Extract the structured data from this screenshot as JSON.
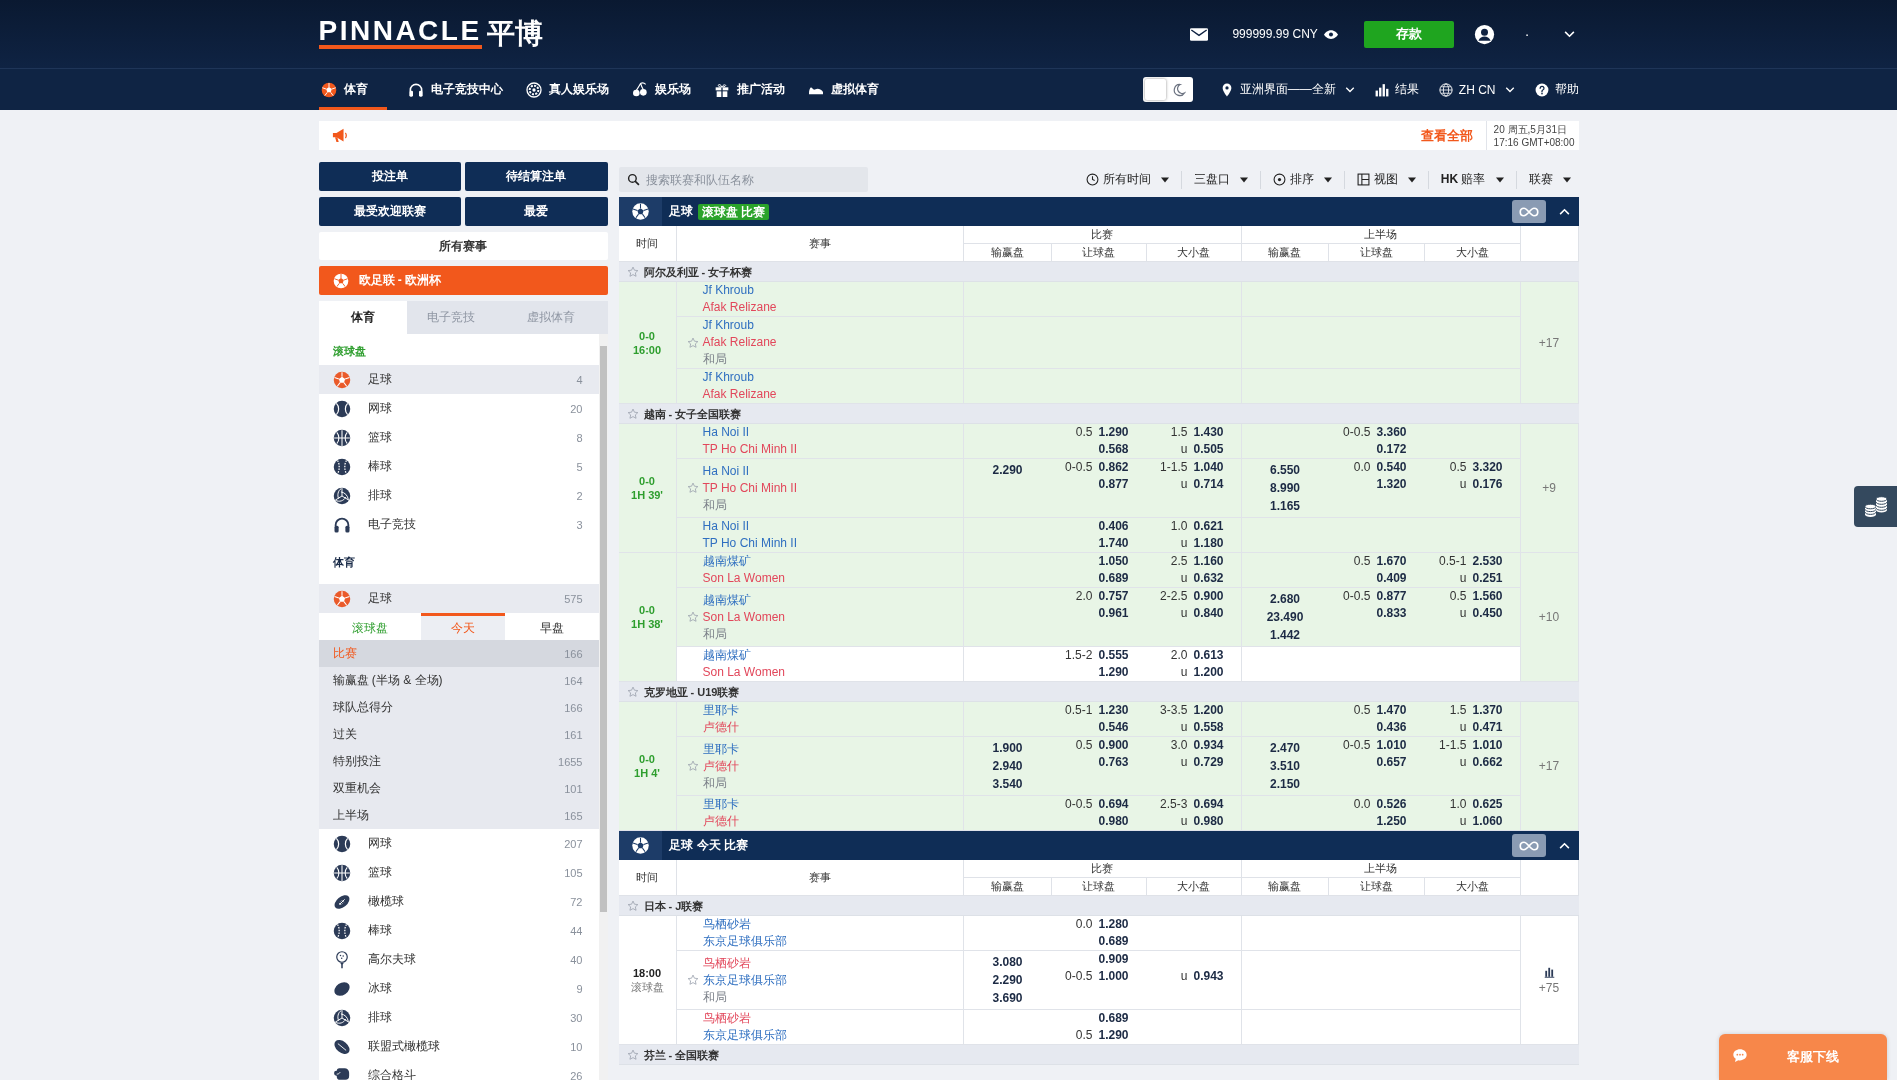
{
  "header": {
    "logo_word": "PINNACLE",
    "logo_chinese": "平博",
    "balance": "999999.99 CNY",
    "deposit": "存款",
    "username": "·"
  },
  "nav": {
    "items": [
      {
        "kind": "soccer",
        "label": "体育",
        "selected": true
      },
      {
        "kind": "headset",
        "label": "电子竞技中心",
        "selected": false
      },
      {
        "kind": "chip",
        "label": "真人娱乐场",
        "selected": false
      },
      {
        "kind": "cherries",
        "label": "娱乐场",
        "selected": false
      },
      {
        "kind": "gift",
        "label": "推广活动",
        "selected": false
      },
      {
        "kind": "virtual",
        "label": "虚拟体育",
        "selected": false
      }
    ],
    "dark_mode": false,
    "view": "亚洲界面——全新",
    "results": "结果",
    "language": "ZH CN",
    "help": "帮助"
  },
  "announcement": {
    "view_all": "查看全部",
    "date": "20 周五,5月31日",
    "time": "17:16 GMT+08:00"
  },
  "sidebar": {
    "buttons": [
      "投注单",
      "待结算注单",
      "最受欢迎联赛",
      "最爱"
    ],
    "all_events": "所有赛事",
    "featured": {
      "kind": "soccer",
      "label": "欧足联 - 欧洲杯"
    },
    "tabs": [
      {
        "label": "体育",
        "selected": true
      },
      {
        "label": "电子竞技",
        "selected": false
      },
      {
        "label": "虚拟体育",
        "selected": false
      }
    ],
    "live_heading": "滚球盘",
    "live_sports": [
      {
        "kind": "soccer",
        "name": "足球",
        "count": "4",
        "selected": true
      },
      {
        "kind": "tennis",
        "name": "网球",
        "count": "20",
        "selected": false
      },
      {
        "kind": "basketball",
        "name": "篮球",
        "count": "8",
        "selected": false
      },
      {
        "kind": "baseball",
        "name": "棒球",
        "count": "5",
        "selected": false
      },
      {
        "kind": "volleyball",
        "name": "排球",
        "count": "2",
        "selected": false
      },
      {
        "kind": "esports",
        "name": "电子竞技",
        "count": "3",
        "selected": false
      }
    ],
    "sports_heading": "体育",
    "sports": [
      {
        "kind": "soccer",
        "name": "足球",
        "count": "575",
        "selected": true,
        "periods": [
          {
            "label": "滚球盘",
            "live": true,
            "selected": false
          },
          {
            "label": "今天",
            "live": false,
            "selected": true
          },
          {
            "label": "早盘",
            "live": false,
            "selected": false
          }
        ],
        "markets": [
          {
            "label": "比赛",
            "count": "166",
            "selected": true
          },
          {
            "label": "输赢盘 (半场 & 全场)",
            "count": "164",
            "selected": false
          },
          {
            "label": "球队总得分",
            "count": "166",
            "selected": false
          },
          {
            "label": "过关",
            "count": "161",
            "selected": false
          },
          {
            "label": "特别投注",
            "count": "1655",
            "selected": false
          },
          {
            "label": "双重机会",
            "count": "101",
            "selected": false
          },
          {
            "label": "上半场",
            "count": "165",
            "selected": false
          }
        ]
      },
      {
        "kind": "tennis",
        "name": "网球",
        "count": "207",
        "selected": false
      },
      {
        "kind": "basketball",
        "name": "篮球",
        "count": "105",
        "selected": false
      },
      {
        "kind": "football",
        "name": "橄榄球",
        "count": "72",
        "selected": false
      },
      {
        "kind": "baseball",
        "name": "棒球",
        "count": "44",
        "selected": false
      },
      {
        "kind": "golf",
        "name": "高尔夫球",
        "count": "40",
        "selected": false
      },
      {
        "kind": "hockey",
        "name": "冰球",
        "count": "9",
        "selected": false
      },
      {
        "kind": "volleyball",
        "name": "排球",
        "count": "30",
        "selected": false
      },
      {
        "kind": "rugby_league",
        "name": "联盟式橄榄球",
        "count": "10",
        "selected": false
      },
      {
        "kind": "mma",
        "name": "综合格斗",
        "count": "26",
        "selected": false
      }
    ]
  },
  "toolbar": {
    "search": {
      "placeholder": "搜索联赛和队伍名称"
    },
    "filters": [
      {
        "kind": "clock",
        "label": "所有时间"
      },
      {
        "kind": "plain",
        "label": "三盘口"
      },
      {
        "kind": "sort",
        "label": "排序"
      },
      {
        "kind": "view",
        "label": "视图"
      },
      {
        "kind": "plain",
        "label": "**HK** 赔率"
      },
      {
        "kind": "plain",
        "label": "联赛"
      }
    ]
  },
  "sections": [
    {
      "kind": "soccer",
      "title": "足球",
      "subtitle": "滚球盘 比赛",
      "live": true,
      "expanded": true,
      "head": {
        "time": "时间",
        "event": "赛事",
        "groups": [
          {
            "label": "比赛",
            "columns": [
              "输赢盘",
              "让球盘",
              "大小盘"
            ]
          },
          {
            "label": "上半场",
            "columns": [
              "输赢盘",
              "让球盘",
              "大小盘"
            ]
          }
        ]
      },
      "leagues": [
        {
          "name": "阿尔及利亚 - 女子杯赛",
          "favorite": false,
          "matches": [
            {
              "time": [
                "0-0",
                "16:00"
              ],
              "live": true,
              "more": "+17",
              "stats": false,
              "lines": [
                {
                  "shaded": true,
                  "home": "Jf Khroub",
                  "home_emphasis": false,
                  "away": "Afak Relizane",
                  "away_emphasis": true
                },
                {
                  "shaded": true,
                  "home": "Jf Khroub",
                  "home_emphasis": false,
                  "away": "Afak Relizane",
                  "away_emphasis": true,
                  "draw": "和局"
                },
                {
                  "shaded": true,
                  "home": "Jf Khroub",
                  "home_emphasis": false,
                  "away": "Afak Relizane",
                  "away_emphasis": true
                }
              ]
            }
          ]
        },
        {
          "name": "越南 - 女子全国联赛",
          "favorite": false,
          "matches": [
            {
              "time": [
                "0-0",
                "1H 39'"
              ],
              "live": true,
              "more": "+9",
              "stats": false,
              "lines": [
                {
                  "shaded": true,
                  "home": "Ha Noi II",
                  "home_emphasis": false,
                  "away": "TP Ho Chi Minh II",
                  "away_emphasis": true,
                  "ft_hdp": {
                    "home_line": "0.5",
                    "home_odds": "1.290",
                    "away_odds": "0.568"
                  },
                  "ft_ou": {
                    "line": "1.5",
                    "over_odds": "1.430",
                    "under": "u",
                    "under_odds": "0.505"
                  },
                  "h1_hdp": {
                    "home_line": "0-0.5",
                    "home_odds": "3.360",
                    "away_odds": "0.172"
                  }
                },
                {
                  "shaded": true,
                  "home": "Ha Noi II",
                  "home_emphasis": false,
                  "away": "TP Ho Chi Minh II",
                  "away_emphasis": true,
                  "draw": "和局",
                  "ft_1x2": [
                    "2.290"
                  ],
                  "ft_hdp": {
                    "home_line": "0-0.5",
                    "home_odds": "0.862",
                    "away_odds": "0.877"
                  },
                  "ft_ou": {
                    "line": "1-1.5",
                    "over_odds": "1.040",
                    "under": "u",
                    "under_odds": "0.714"
                  },
                  "h1_1x2": [
                    "6.550",
                    "8.990",
                    "1.165"
                  ],
                  "h1_hdp": {
                    "home_line": "0.0",
                    "home_odds": "0.540",
                    "away_odds": "1.320"
                  },
                  "h1_ou": {
                    "line": "0.5",
                    "over_odds": "3.320",
                    "under": "u",
                    "under_odds": "0.176"
                  }
                },
                {
                  "shaded": true,
                  "home": "Ha Noi II",
                  "home_emphasis": false,
                  "away": "TP Ho Chi Minh II",
                  "away_emphasis": false,
                  "ft_hdp": {
                    "home_odds": "0.406",
                    "away_odds": "1.740"
                  },
                  "ft_ou": {
                    "line": "1.0",
                    "over_odds": "0.621",
                    "under": "u",
                    "under_odds": "1.180"
                  }
                }
              ]
            },
            {
              "time": [
                "0-0",
                "1H 38'"
              ],
              "live": true,
              "more": "+10",
              "stats": false,
              "lines": [
                {
                  "shaded": true,
                  "home": "越南煤矿",
                  "home_emphasis": false,
                  "away": "Son La Women",
                  "away_emphasis": true,
                  "ft_hdp": {
                    "home_odds": "1.050",
                    "away_odds": "0.689"
                  },
                  "ft_ou": {
                    "line": "2.5",
                    "over_odds": "1.160",
                    "under": "u",
                    "under_odds": "0.632"
                  },
                  "h1_hdp": {
                    "home_line": "0.5",
                    "home_odds": "1.670",
                    "away_odds": "0.409"
                  },
                  "h1_ou": {
                    "line": "0.5-1",
                    "over_odds": "2.530",
                    "under": "u",
                    "under_odds": "0.251"
                  }
                },
                {
                  "shaded": true,
                  "home": "越南煤矿",
                  "home_emphasis": false,
                  "away": "Son La Women",
                  "away_emphasis": true,
                  "draw": "和局",
                  "ft_hdp": {
                    "home_line": "2.0",
                    "home_odds": "0.757",
                    "away_odds": "0.961"
                  },
                  "ft_ou": {
                    "line": "2-2.5",
                    "over_odds": "0.900",
                    "under": "u",
                    "under_odds": "0.840"
                  },
                  "h1_1x2": [
                    "2.680",
                    "23.490",
                    "1.442"
                  ],
                  "h1_hdp": {
                    "home_line": "0-0.5",
                    "home_odds": "0.877",
                    "away_odds": "0.833"
                  },
                  "h1_ou": {
                    "line": "0.5",
                    "over_odds": "1.560",
                    "under": "u",
                    "under_odds": "0.450"
                  }
                },
                {
                  "shaded": false,
                  "home": "越南煤矿",
                  "home_emphasis": false,
                  "away": "Son La Women",
                  "away_emphasis": true,
                  "ft_hdp": {
                    "home_line": "1.5-2",
                    "home_odds": "0.555",
                    "away_odds": "1.290"
                  },
                  "ft_ou": {
                    "line": "2.0",
                    "over_odds": "0.613",
                    "under": "u",
                    "under_odds": "1.200"
                  }
                }
              ]
            }
          ]
        },
        {
          "name": "克罗地亚 - U19联赛",
          "favorite": false,
          "matches": [
            {
              "time": [
                "0-0",
                "1H 4'"
              ],
              "live": true,
              "more": "+17",
              "stats": false,
              "lines": [
                {
                  "shaded": true,
                  "home": "里耶卡",
                  "home_emphasis": false,
                  "away": "卢德什",
                  "away_emphasis": true,
                  "ft_hdp": {
                    "home_line": "0.5-1",
                    "home_odds": "1.230",
                    "away_odds": "0.546"
                  },
                  "ft_ou": {
                    "line": "3-3.5",
                    "over_odds": "1.200",
                    "under": "u",
                    "under_odds": "0.558"
                  },
                  "h1_hdp": {
                    "home_line": "0.5",
                    "home_odds": "1.470",
                    "away_odds": "0.436"
                  },
                  "h1_ou": {
                    "line": "1.5",
                    "over_odds": "1.370",
                    "under": "u",
                    "under_odds": "0.471"
                  }
                },
                {
                  "shaded": true,
                  "home": "里耶卡",
                  "home_emphasis": false,
                  "away": "卢德什",
                  "away_emphasis": true,
                  "draw": "和局",
                  "ft_1x2": [
                    "1.900",
                    "2.940",
                    "3.540"
                  ],
                  "ft_hdp": {
                    "home_line": "0.5",
                    "home_odds": "0.900",
                    "away_odds": "0.763"
                  },
                  "ft_ou": {
                    "line": "3.0",
                    "over_odds": "0.934",
                    "under": "u",
                    "under_odds": "0.729"
                  },
                  "h1_1x2": [
                    "2.470",
                    "3.510",
                    "2.150"
                  ],
                  "h1_hdp": {
                    "home_line": "0-0.5",
                    "home_odds": "1.010",
                    "away_odds": "0.657"
                  },
                  "h1_ou": {
                    "line": "1-1.5",
                    "over_odds": "1.010",
                    "under": "u",
                    "under_odds": "0.662"
                  }
                },
                {
                  "shaded": true,
                  "home": "里耶卡",
                  "home_emphasis": false,
                  "away": "卢德什",
                  "away_emphasis": true,
                  "ft_hdp": {
                    "home_line": "0-0.5",
                    "home_odds": "0.694",
                    "away_odds": "0.980"
                  },
                  "ft_ou": {
                    "line": "2.5-3",
                    "over_odds": "0.694",
                    "under": "u",
                    "under_odds": "0.980"
                  },
                  "h1_hdp": {
                    "home_line": "0.0",
                    "home_odds": "0.526",
                    "away_odds": "1.250"
                  },
                  "h1_ou": {
                    "line": "1.0",
                    "over_odds": "0.625",
                    "under": "u",
                    "under_odds": "1.060"
                  }
                }
              ]
            }
          ]
        }
      ]
    },
    {
      "kind": "soccer",
      "title": "足球",
      "subtitle": "今天 比赛",
      "live": false,
      "expanded": true,
      "head": {
        "time": "时间",
        "event": "赛事",
        "groups": [
          {
            "label": "比赛",
            "columns": [
              "输赢盘",
              "让球盘",
              "大小盘"
            ]
          },
          {
            "label": "上半场",
            "columns": [
              "输赢盘",
              "让球盘",
              "大小盘"
            ]
          }
        ]
      },
      "leagues": [
        {
          "name": "日本 - J联赛",
          "favorite": false,
          "matches": [
            {
              "time": [
                "18:00",
                "滚球盘"
              ],
              "live": false,
              "more": "+75",
              "stats": true,
              "lines": [
                {
                  "shaded": false,
                  "home": "鸟栖砂岩",
                  "home_emphasis": false,
                  "away": "东京足球俱乐部",
                  "away_emphasis": false,
                  "ft_hdp": {
                    "home_line": "0.0",
                    "home_odds": "1.280",
                    "away_odds": "0.689"
                  }
                },
                {
                  "shaded": false,
                  "home": "鸟栖砂岩",
                  "home_emphasis": true,
                  "away": "东京足球俱乐部",
                  "away_emphasis": false,
                  "draw": "和局",
                  "ft_1x2": [
                    "3.080",
                    "2.290",
                    "3.690"
                  ],
                  "ft_hdp": {
                    "away_line": "0-0.5",
                    "home_odds": "0.909",
                    "away_odds": "1.000"
                  },
                  "ft_ou": {
                    "under": "u",
                    "under_odds": "0.943"
                  }
                },
                {
                  "shaded": false,
                  "home": "鸟栖砂岩",
                  "home_emphasis": true,
                  "away": "东京足球俱乐部",
                  "away_emphasis": false,
                  "ft_hdp": {
                    "away_line": "0.5",
                    "home_odds": "0.689",
                    "away_odds": "1.290"
                  }
                }
              ]
            }
          ]
        },
        {
          "name": "芬兰 - 全国联赛",
          "favorite": false
        }
      ]
    }
  ],
  "floating": {
    "chat": "客服下线"
  }
}
